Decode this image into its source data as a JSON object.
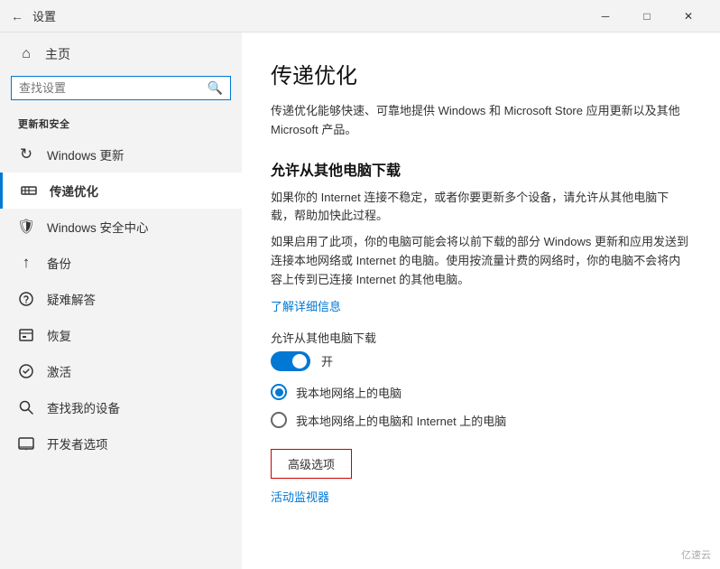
{
  "titlebar": {
    "back_icon": "←",
    "title": "设置",
    "minimize_label": "─",
    "restore_label": "□",
    "close_label": "✕"
  },
  "sidebar": {
    "home_label": "主页",
    "search_placeholder": "查找设置",
    "section_title": "更新和安全",
    "items": [
      {
        "id": "windows-update",
        "icon": "↻",
        "label": "Windows 更新",
        "active": false
      },
      {
        "id": "delivery-optimization",
        "icon": "🖧",
        "label": "传递优化",
        "active": true
      },
      {
        "id": "windows-security",
        "icon": "🛡",
        "label": "Windows 安全中心",
        "active": false
      },
      {
        "id": "backup",
        "icon": "↑",
        "label": "备份",
        "active": false
      },
      {
        "id": "troubleshoot",
        "icon": "🔑",
        "label": "疑难解答",
        "active": false
      },
      {
        "id": "recovery",
        "icon": "🖥",
        "label": "恢复",
        "active": false
      },
      {
        "id": "activation",
        "icon": "✓",
        "label": "激活",
        "active": false
      },
      {
        "id": "find-device",
        "icon": "🔍",
        "label": "查找我的设备",
        "active": false
      },
      {
        "id": "developer",
        "icon": "💻",
        "label": "开发者选项",
        "active": false
      }
    ]
  },
  "content": {
    "title": "传递优化",
    "description": "传递优化能够快速、可靠地提供 Windows 和 Microsoft Store 应用更新以及其他 Microsoft 产品。",
    "allow_section_heading": "允许从其他电脑下载",
    "allow_section_text1": "如果你的 Internet 连接不稳定，或者你要更新多个设备，请允许从其他电脑下载，帮助加快此过程。",
    "allow_section_text2": "如果启用了此项，你的电脑可能会将以前下载的部分 Windows 更新和应用发送到连接本地网络或 Internet 的电脑。使用按流量计费的网络时，你的电脑不会将内容上传到已连接 Internet 的其他电脑。",
    "learn_more_link": "了解详细信息",
    "toggle_label_prefix": "允许从其他电脑下载",
    "toggle_state": "开",
    "radio_option1": "我本地网络上的电脑",
    "radio_option2": "我本地网络上的电脑和 Internet 上的电脑",
    "advanced_btn_label": "高级选项",
    "monitor_link": "活动监视器",
    "watermark": "亿速云"
  }
}
